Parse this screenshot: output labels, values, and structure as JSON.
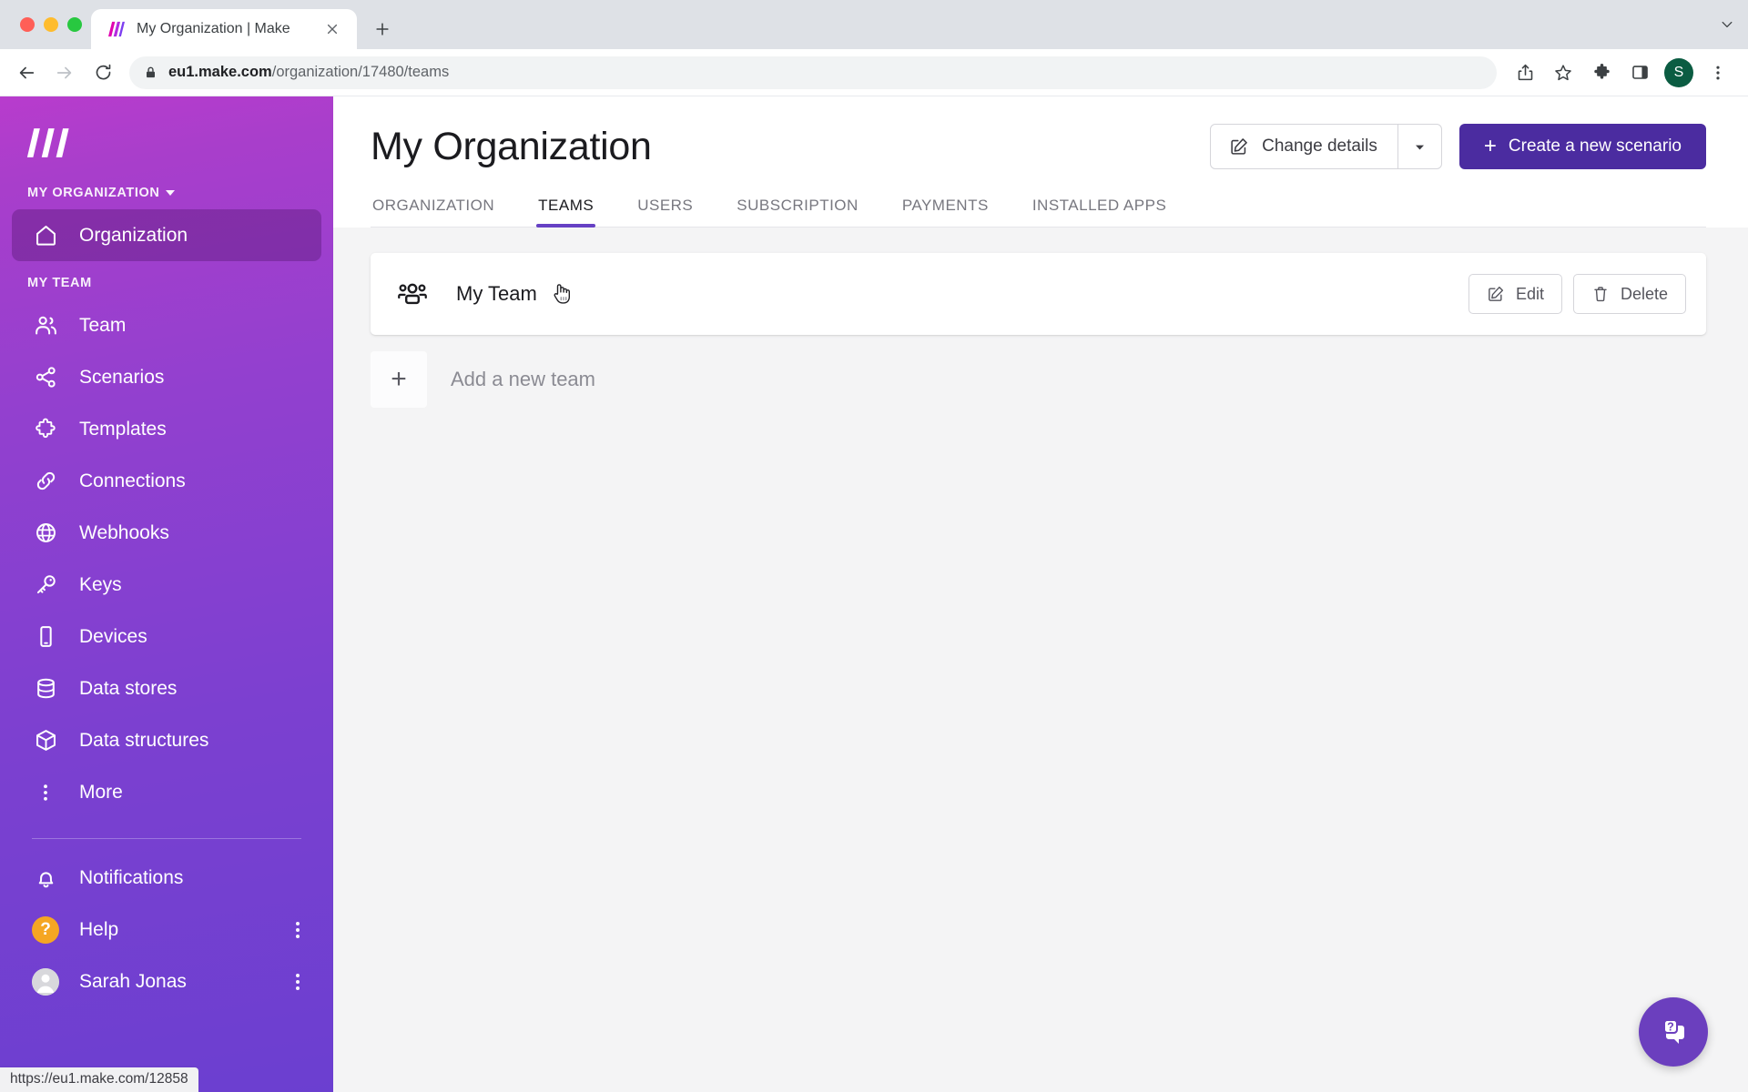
{
  "browser": {
    "tab": {
      "title": "My Organization | Make",
      "favicon_icon": "make-logo-icon",
      "close_icon": "close-icon"
    },
    "new_tab_label": "+",
    "tabstrip_chevron_icon": "chevron-down-icon",
    "nav": {
      "back_icon": "arrow-left-icon",
      "forward_icon": "arrow-right-icon",
      "reload_icon": "reload-icon"
    },
    "omnibox": {
      "lock_icon": "lock-icon",
      "url_host": "eu1.make.com",
      "url_path": "/organization/17480/teams",
      "full_url": "eu1.make.com/organization/17480/teams"
    },
    "actions": {
      "share_icon": "share-icon",
      "bookmark_icon": "star-icon",
      "extensions_icon": "puzzle-icon",
      "side_panel_icon": "side-panel-icon",
      "profile_initial": "S",
      "profile_color": "#0b5c42",
      "menu_icon": "three-dots-vertical-icon"
    },
    "status_bar_url": "https://eu1.make.com/12858"
  },
  "sidebar": {
    "logo_icon": "make-logo-icon",
    "org_switcher": {
      "label": "MY ORGANIZATION",
      "caret_icon": "chevron-down-icon"
    },
    "org_items": [
      {
        "label": "Organization",
        "icon": "home-icon",
        "active": true
      }
    ],
    "team_section_label": "MY TEAM",
    "team_items": [
      {
        "label": "Team",
        "icon": "users-icon"
      },
      {
        "label": "Scenarios",
        "icon": "share-nodes-icon"
      },
      {
        "label": "Templates",
        "icon": "puzzle-icon"
      },
      {
        "label": "Connections",
        "icon": "link-icon"
      },
      {
        "label": "Webhooks",
        "icon": "globe-icon"
      },
      {
        "label": "Keys",
        "icon": "key-icon"
      },
      {
        "label": "Devices",
        "icon": "mobile-icon"
      },
      {
        "label": "Data stores",
        "icon": "database-icon"
      },
      {
        "label": "Data structures",
        "icon": "cube-icon"
      },
      {
        "label": "More",
        "icon": "three-dots-vertical-icon"
      }
    ],
    "footer_items": [
      {
        "label": "Notifications",
        "icon": "bell-icon",
        "has_menu": false
      },
      {
        "label": "Help",
        "icon": "help-badge-icon",
        "has_menu": true
      },
      {
        "label": "Sarah Jonas",
        "icon": "avatar-icon",
        "has_menu": true
      }
    ],
    "accent_top": "#b83ccd",
    "accent_bottom": "#6b3fd0"
  },
  "header": {
    "title": "My Organization",
    "change_details": {
      "label": "Change details",
      "icon": "pencil-square-icon",
      "caret_icon": "chevron-down-icon"
    },
    "create_scenario": {
      "label": "Create a new scenario",
      "plus": "+",
      "color": "#4b2ca0"
    }
  },
  "tabs": [
    {
      "label": "ORGANIZATION",
      "active": false
    },
    {
      "label": "TEAMS",
      "active": true
    },
    {
      "label": "USERS",
      "active": false
    },
    {
      "label": "SUBSCRIPTION",
      "active": false
    },
    {
      "label": "PAYMENTS",
      "active": false
    },
    {
      "label": "INSTALLED APPS",
      "active": false
    }
  ],
  "teams": {
    "rows": [
      {
        "name": "My Team",
        "icon": "users-group-icon",
        "edit_label": "Edit",
        "edit_icon": "pencil-square-icon",
        "delete_label": "Delete",
        "delete_icon": "trash-icon"
      }
    ],
    "add_team": {
      "plus": "+",
      "label": "Add a new team"
    }
  },
  "help_widget": {
    "icon": "help-chat-icon",
    "color": "#6b3fbe"
  }
}
